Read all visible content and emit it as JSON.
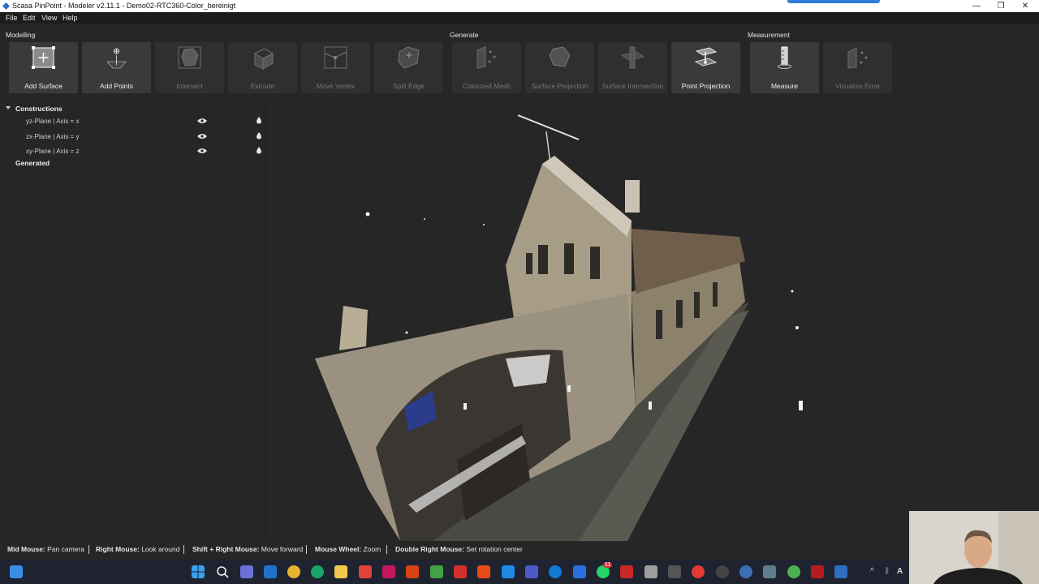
{
  "window": {
    "title": "Scasa PinPoint - Modeler v2.11.1 - Demo02-RTC360-Color_bereinigt",
    "controls": {
      "minimize": "—",
      "restore": "❐",
      "close": "✕"
    }
  },
  "menu": {
    "items": [
      "File",
      "Edit",
      "View",
      "Help"
    ]
  },
  "ribbon": {
    "groups": {
      "modelling": "Modelling",
      "generate": "Generate",
      "measurement": "Measurement"
    },
    "tools": [
      {
        "label": "Add Surface",
        "icon": "add-surface-icon",
        "enabled": true
      },
      {
        "label": "Add Points",
        "icon": "add-points-icon",
        "enabled": true
      },
      {
        "label": "Intersect",
        "icon": "intersect-icon",
        "enabled": false
      },
      {
        "label": "Extrude",
        "icon": "extrude-icon",
        "enabled": false
      },
      {
        "label": "Move Vertex",
        "icon": "move-vertex-icon",
        "enabled": false
      },
      {
        "label": "Split Edge",
        "icon": "split-edge-icon",
        "enabled": false
      },
      {
        "label": "Colorized Mesh",
        "icon": "colorized-mesh-icon",
        "enabled": false
      },
      {
        "label": "Surface Projection",
        "icon": "surface-projection-icon",
        "enabled": false
      },
      {
        "label": "Surface Intersection",
        "icon": "surface-intersection-icon",
        "enabled": false
      },
      {
        "label": "Point Projection",
        "icon": "point-projection-icon",
        "enabled": true
      },
      {
        "label": "Measure",
        "icon": "measure-icon",
        "enabled": true
      },
      {
        "label": "Visualize Error",
        "icon": "visualize-error-icon",
        "enabled": false
      }
    ]
  },
  "tree": {
    "constructions": "Constructions",
    "items": [
      "yz-Plane | Axis = x",
      "zx-Plane | Axis = y",
      "xy-Plane | Axis = z"
    ],
    "generated": "Generated"
  },
  "status": {
    "hints": [
      {
        "key": "Mid Mouse:",
        "action": "Pan camera"
      },
      {
        "key": "Right Mouse:",
        "action": "Look around"
      },
      {
        "key": "Shift + Right Mouse:",
        "action": "Move forward"
      },
      {
        "key": "Mouse Wheel:",
        "action": "Zoom"
      },
      {
        "key": "Double Right Mouse:",
        "action": "Set rotation center"
      }
    ]
  },
  "taskbar": {
    "notification_badge": "11",
    "tray_letter": "A"
  },
  "colors": {
    "background": "#262626",
    "tool_enabled": "#3a3a3a",
    "tool_disabled": "#2f2f2f",
    "windows_accent": "#2c7fd6"
  }
}
